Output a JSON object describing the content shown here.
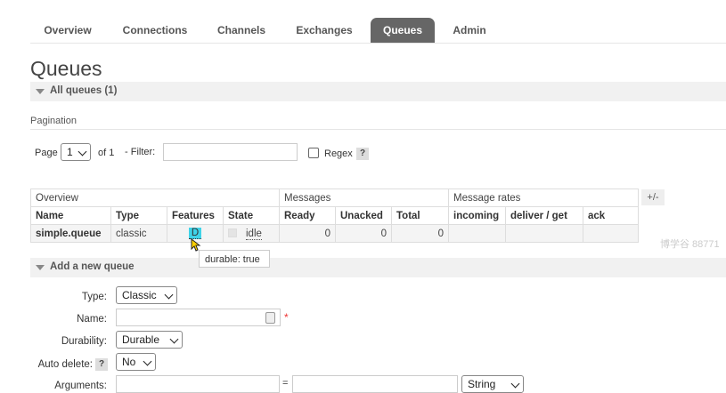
{
  "tabs": [
    {
      "label": "Overview",
      "active": false
    },
    {
      "label": "Connections",
      "active": false
    },
    {
      "label": "Channels",
      "active": false
    },
    {
      "label": "Exchanges",
      "active": false
    },
    {
      "label": "Queues",
      "active": true
    },
    {
      "label": "Admin",
      "active": false
    }
  ],
  "page_title": "Queues",
  "all_queues_label": "All queues (1)",
  "pagination": {
    "section_label": "Pagination",
    "page_label": "Page",
    "page_value": "1",
    "of_label": "of 1",
    "filter_label": "- Filter:",
    "filter_value": "",
    "regex_label": "Regex",
    "help": "?"
  },
  "table": {
    "groups": {
      "overview": "Overview",
      "messages": "Messages",
      "rates": "Message rates"
    },
    "plus_minus": "+/-",
    "columns": [
      "Name",
      "Type",
      "Features",
      "State",
      "Ready",
      "Unacked",
      "Total",
      "incoming",
      "deliver / get",
      "ack"
    ],
    "row": {
      "name": "simple.queue",
      "type": "classic",
      "feature": "D",
      "state": "idle",
      "ready": "0",
      "unacked": "0",
      "total": "0",
      "incoming": "",
      "deliver_get": "",
      "ack": ""
    }
  },
  "tooltip": "durable: true",
  "watermark": "博学谷 88771",
  "add_queue": {
    "section_label": "Add a new queue",
    "type_label": "Type:",
    "type_value": "Classic",
    "name_label": "Name:",
    "name_value": "",
    "required_mark": "*",
    "durability_label": "Durability:",
    "durability_value": "Durable",
    "auto_delete_label": "Auto delete:",
    "auto_delete_help": "?",
    "auto_delete_value": "No",
    "arguments_label": "Arguments:",
    "equals": "=",
    "arg_type_value": "String"
  },
  "colors": {
    "active_tab": "#666666",
    "section_bg": "#f1f1f1",
    "tooltip_highlight": "#3fd3e8"
  }
}
